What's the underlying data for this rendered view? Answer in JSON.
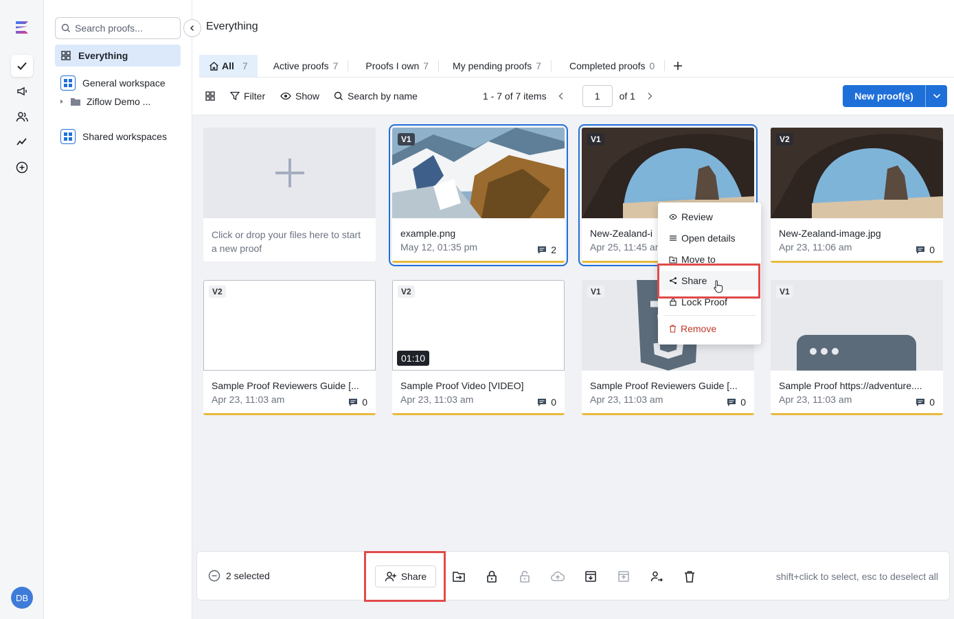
{
  "rail": {
    "avatar_initials": "DB",
    "items": [
      "checkmark-icon",
      "megaphone-icon",
      "users-icon",
      "activity-icon",
      "add-circle-icon"
    ]
  },
  "sidebar": {
    "search_placeholder": "Search proofs...",
    "items": [
      {
        "label": "Everything"
      },
      {
        "label": "General workspace"
      },
      {
        "label": "Ziflow Demo ..."
      },
      {
        "label": "Shared workspaces"
      }
    ]
  },
  "header": {
    "title": "Everything"
  },
  "tabs": [
    {
      "label": "All",
      "count": "7"
    },
    {
      "label": "Active proofs",
      "count": "7"
    },
    {
      "label": "Proofs I own",
      "count": "7"
    },
    {
      "label": "My pending proofs",
      "count": "7"
    },
    {
      "label": "Completed proofs",
      "count": "0"
    }
  ],
  "toolbar": {
    "filter_label": "Filter",
    "show_label": "Show",
    "search_label": "Search by name",
    "items_range": "1 - 7 of 7 items",
    "page_value": "1",
    "page_of": "of 1",
    "new_button_label": "New proof(s)"
  },
  "upload_card": {
    "hint": "Click or drop your files here to start a new proof"
  },
  "cards": [
    {
      "version": "V1",
      "name": "example.png",
      "date": "May 12, 01:35 pm",
      "comments": "2"
    },
    {
      "version": "V1",
      "name": "New-Zealand-i",
      "date": "Apr 25, 11:45 am",
      "comments": ""
    },
    {
      "version": "V2",
      "name": "New-Zealand-image.jpg",
      "date": "Apr 23, 11:06 am",
      "comments": "0"
    },
    {
      "version": "V2",
      "name": "Sample Proof Reviewers Guide [...",
      "date": "Apr 23, 11:03 am",
      "comments": "0"
    },
    {
      "version": "V2",
      "name": "Sample Proof Video [VIDEO]",
      "date": "Apr 23, 11:03 am",
      "comments": "0",
      "duration": "01:10"
    },
    {
      "version": "V1",
      "name": "Sample Proof Reviewers Guide [...",
      "date": "Apr 23, 11:03 am",
      "comments": "0"
    },
    {
      "version": "V1",
      "name": "Sample Proof https://adventure....",
      "date": "Apr 23, 11:03 am",
      "comments": "0"
    }
  ],
  "context_menu": {
    "items": [
      "Review",
      "Open details",
      "Move to",
      "Share",
      "Lock Proof",
      "Remove"
    ]
  },
  "bulk_bar": {
    "selected_label": "2 selected",
    "share_label": "Share",
    "hint": "shift+click to select, esc to deselect all"
  },
  "colors": {
    "accent": "#1f6fd9",
    "highlight": "#e04a4a",
    "status_bar": "#e9b93c"
  }
}
